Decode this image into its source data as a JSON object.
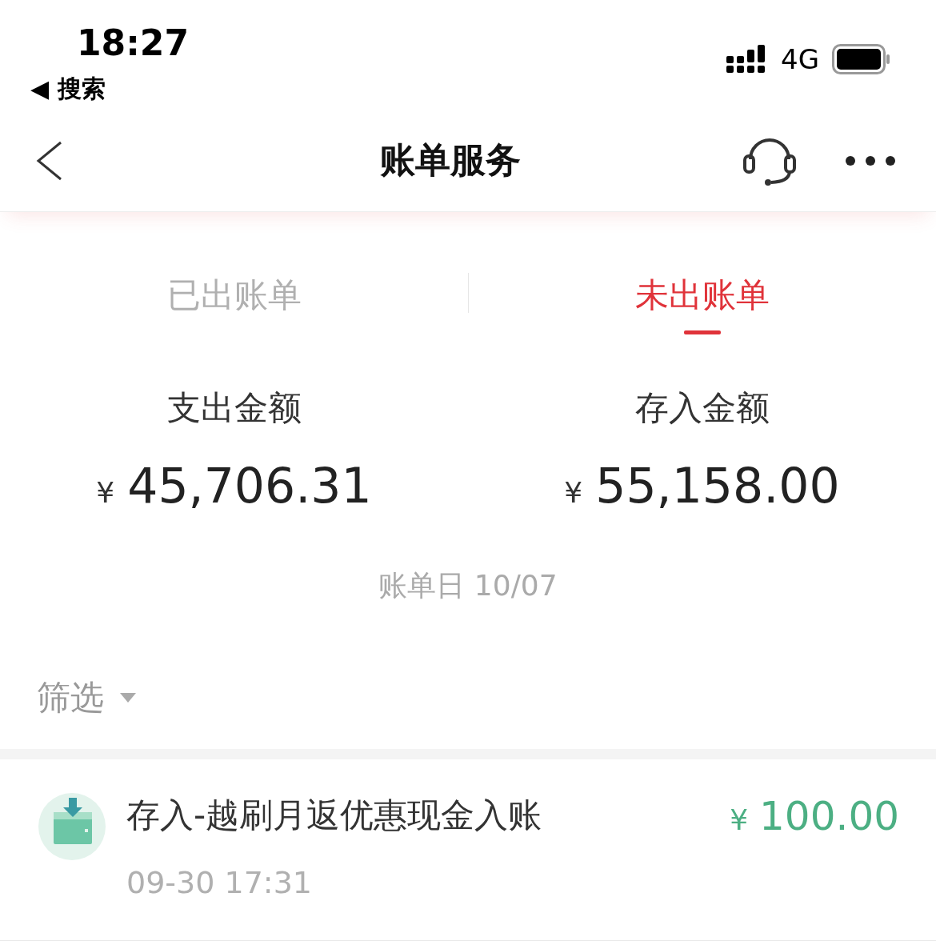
{
  "status_bar": {
    "time": "18:27",
    "back_app": "◀ 搜索",
    "network": "4G"
  },
  "nav": {
    "title": "账单服务"
  },
  "tabs": [
    {
      "label": "已出账单",
      "selected": false
    },
    {
      "label": "未出账单",
      "selected": true
    }
  ],
  "summary": [
    {
      "label": "支出金额",
      "currency": "¥",
      "amount": "45,706.31"
    },
    {
      "label": "存入金额",
      "currency": "¥",
      "amount": "55,158.00"
    }
  ],
  "bill_date": "账单日 10/07",
  "filter": {
    "label": "筛选"
  },
  "transactions": [
    {
      "title": "存入-越刷月返优惠现金入账",
      "time": "09-30 17:31",
      "currency": "¥",
      "amount": "100.00",
      "color": "#4caf83"
    }
  ]
}
